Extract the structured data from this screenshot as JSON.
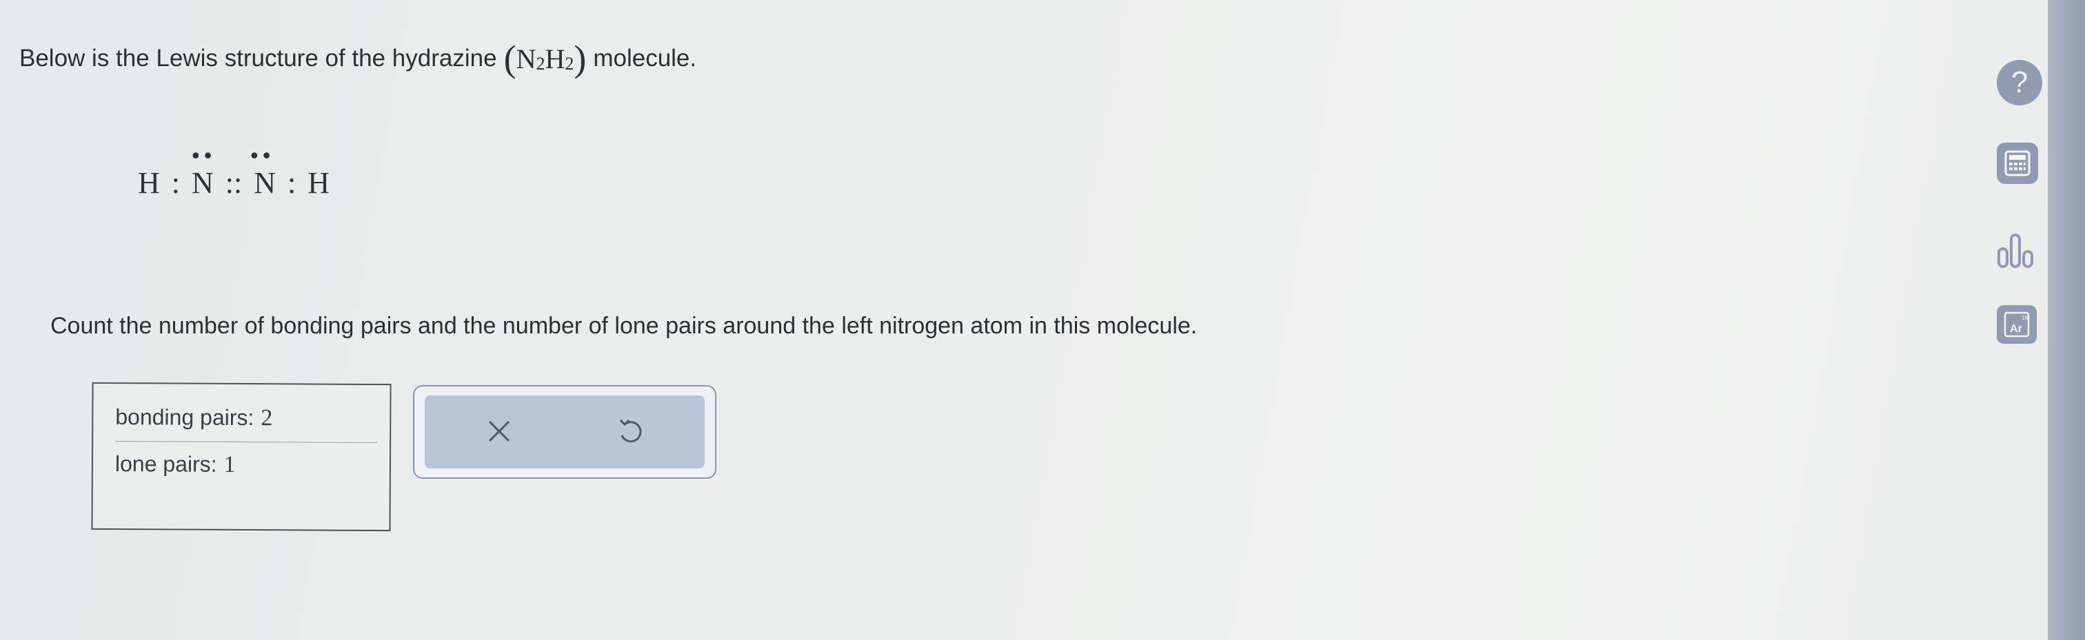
{
  "intro": {
    "text_before": "Below is the Lewis structure of the hydrazine",
    "formula_open": "(",
    "formula_n": "N",
    "formula_n_sub": "2",
    "formula_h": "H",
    "formula_h_sub": "2",
    "formula_close": ")",
    "text_after": "molecule."
  },
  "lewis": {
    "h1": "H",
    "bond1": ":",
    "n1": "N",
    "double_bond": "::",
    "n2": "N",
    "bond2": ":",
    "h2": "H",
    "lone_pair_n1": "••",
    "lone_pair_n2": "••"
  },
  "question": "Count the number of bonding pairs and the number of lone pairs around the left nitrogen atom in this molecule.",
  "answer": {
    "bonding_label": "bonding pairs:",
    "bonding_value": "2",
    "lone_label": "lone pairs:",
    "lone_value": "1"
  },
  "actions": {
    "clear_icon": "x-icon",
    "undo_icon": "undo-icon"
  },
  "sidebar": {
    "help_label": "?",
    "icons": [
      "help-icon",
      "calculator-icon",
      "data-chart-icon",
      "periodic-table-icon"
    ],
    "periodic_symbol": "Ar",
    "periodic_number": "18"
  },
  "colors": {
    "tool_button": "#8e9bb1",
    "action_bar": "#b9c5d8",
    "text": "#2c2f33"
  }
}
